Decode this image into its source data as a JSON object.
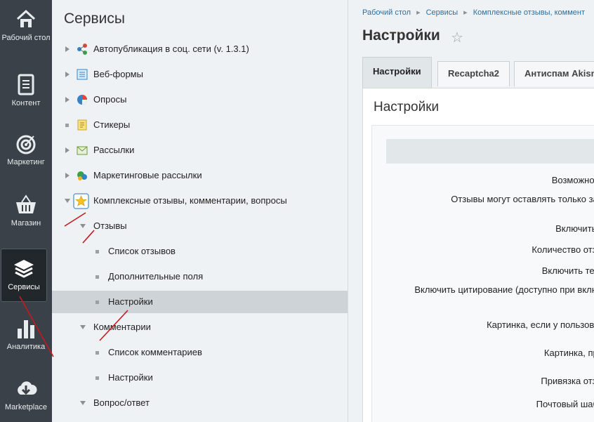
{
  "leftbar": {
    "items": [
      {
        "label": "Рабочий стол",
        "icon": "home-icon"
      },
      {
        "label": "Контент",
        "icon": "document-icon"
      },
      {
        "label": "Маркетинг",
        "icon": "target-icon"
      },
      {
        "label": "Магазин",
        "icon": "basket-icon"
      },
      {
        "label": "Сервисы",
        "icon": "layers-icon"
      },
      {
        "label": "Аналитика",
        "icon": "bar-chart-icon"
      },
      {
        "label": "Marketplace",
        "icon": "cloud-download-icon"
      }
    ]
  },
  "menu": {
    "title": "Сервисы",
    "items": [
      {
        "label": "Автопубликация в соц. сети (v. 1.3.1)"
      },
      {
        "label": "Веб-формы"
      },
      {
        "label": "Опросы"
      },
      {
        "label": "Стикеры"
      },
      {
        "label": "Рассылки"
      },
      {
        "label": "Маркетинговые рассылки"
      },
      {
        "label": "Комплексные отзывы, комментарии, вопросы"
      },
      {
        "label": "Отзывы"
      },
      {
        "label": "Список отзывов"
      },
      {
        "label": "Дополнительные поля"
      },
      {
        "label": "Настройки"
      },
      {
        "label": "Комментарии"
      },
      {
        "label": "Список комментариев"
      },
      {
        "label": "Настройки"
      },
      {
        "label": "Вопрос/ответ"
      }
    ]
  },
  "content": {
    "breadcrumbs": [
      "Рабочий стол",
      "Сервисы",
      "Комплексные отзывы, коммент"
    ],
    "page_title": "Настройки",
    "tabs": [
      "Настройки",
      "Recaptcha2",
      "Антиспам Akism"
    ],
    "panel_title": "Настройки",
    "rows": [
      "Возможност",
      "Отзывы могут оставлять только зар",
      "Включить з",
      "Количество отзы",
      "Включить текс",
      "Включить цитирование (доступно при включ",
      "Картинка, если у пользоват",
      "Картинка, при",
      "Привязка отзы",
      "Почтовый шабл"
    ]
  },
  "colors": {
    "leftbar_bg": "#3b4148",
    "link": "#2d6e9f",
    "annotation": "#c8181e"
  }
}
